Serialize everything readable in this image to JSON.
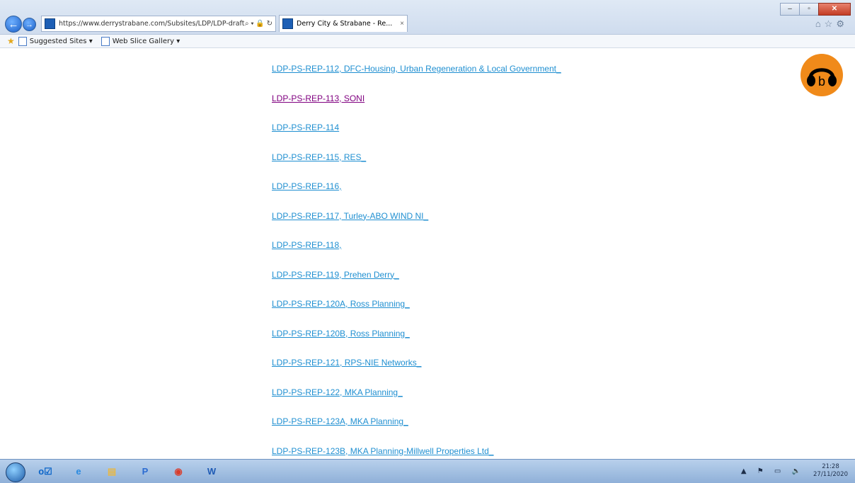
{
  "browser": {
    "url": "https://www.derrystrabane.com/Subsites/LDP/LDP-draft-Plar",
    "tab_title": "Derry City & Strabane - Re...",
    "tab_close": "×",
    "addr_icons": "⌕ ▾ 🔒 ↻",
    "toolbar_icons": "⌂☆⚙"
  },
  "window_controls": {
    "minimize": "–",
    "maximize": "▫",
    "close": "✕"
  },
  "favorites_bar": {
    "items": [
      "Suggested Sites ▾",
      "Web Slice Gallery ▾"
    ]
  },
  "links": [
    {
      "label": "LDP-PS-REP-112, DFC-Housing, Urban Regeneration & Local Government_",
      "visited": false
    },
    {
      "label": "LDP-PS-REP-113, SONI",
      "visited": true
    },
    {
      "label": "LDP-PS-REP-114",
      "visited": false
    },
    {
      "label": "LDP-PS-REP-115, RES_",
      "visited": false
    },
    {
      "label": "LDP-PS-REP-116,",
      "visited": false
    },
    {
      "label": "LDP-PS-REP-117, Turley-ABO WIND NI_",
      "visited": false
    },
    {
      "label": "LDP-PS-REP-118,",
      "visited": false
    },
    {
      "label": "LDP-PS-REP-119, Prehen Derry_",
      "visited": false
    },
    {
      "label": "LDP-PS-REP-120A, Ross Planning_",
      "visited": false
    },
    {
      "label": "LDP-PS-REP-120B, Ross Planning_",
      "visited": false
    },
    {
      "label": "LDP-PS-REP-121, RPS-NIE Networks_",
      "visited": false
    },
    {
      "label": "LDP-PS-REP-122, MKA Planning_",
      "visited": false
    },
    {
      "label": "LDP-PS-REP-123A, MKA Planning_",
      "visited": false
    },
    {
      "label": "LDP-PS-REP-123B, MKA Planning-Millwell Properties Ltd_",
      "visited": false
    }
  ],
  "taskbar": {
    "apps": [
      {
        "icon": "outlook-icon",
        "glyph": "o☑",
        "color": "#0a64c8"
      },
      {
        "icon": "internet-explorer-icon",
        "glyph": "e",
        "color": "#2a8ae0"
      },
      {
        "icon": "file-explorer-icon",
        "glyph": "▤",
        "color": "#e6b84a"
      },
      {
        "icon": "powerpoint-icon",
        "glyph": "P",
        "color": "#2b6bd1"
      },
      {
        "icon": "chrome-icon",
        "glyph": "◉",
        "color": "#d93c2b"
      },
      {
        "icon": "word-icon",
        "glyph": "W",
        "color": "#1f5bb5"
      }
    ],
    "tray_icons": "▲ ⚑ ▭ 🔈",
    "time": "21:28",
    "date": "27/11/2020"
  }
}
